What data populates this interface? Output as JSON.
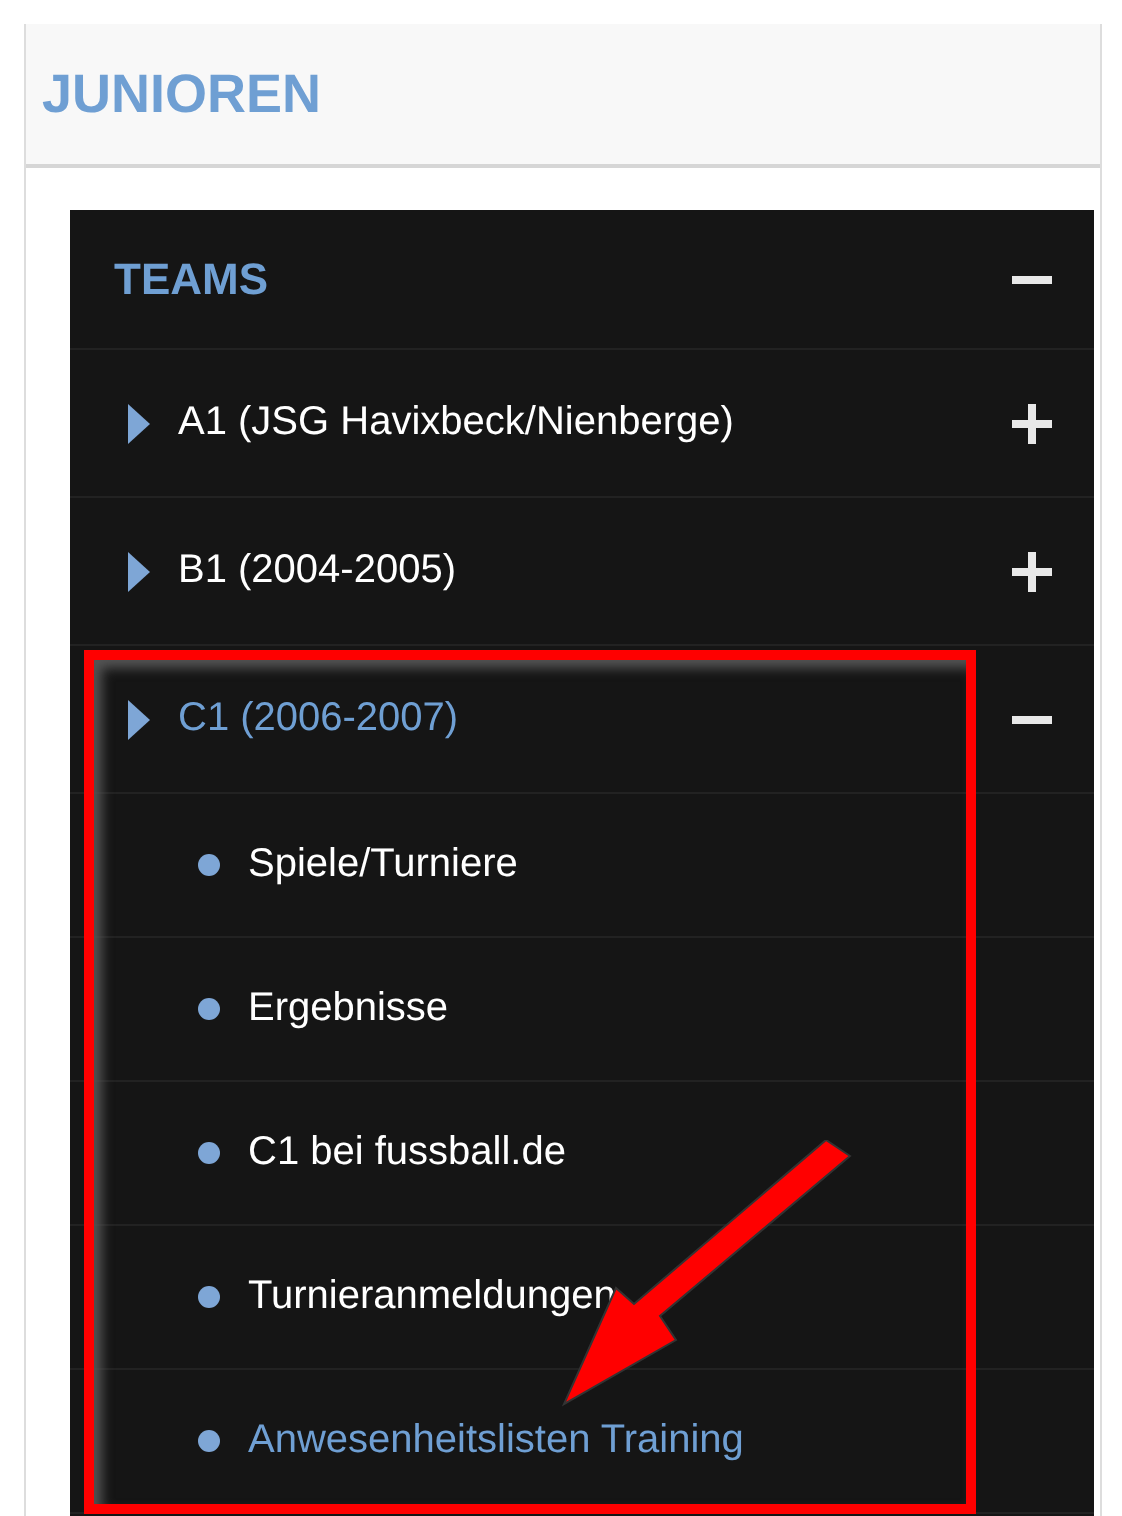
{
  "header": {
    "title": "JUNIOREN"
  },
  "menu": {
    "title": "TEAMS",
    "expanded": true,
    "teams": [
      {
        "label": "A1 (JSG Havixbeck/Nienberge)",
        "expanded": false,
        "selected": false
      },
      {
        "label": "B1 (2004-2005)",
        "expanded": false,
        "selected": false
      },
      {
        "label": "C1 (2006-2007)",
        "expanded": true,
        "selected": true,
        "children": [
          {
            "label": "Spiele/Turniere",
            "selected": false
          },
          {
            "label": "Ergebnisse",
            "selected": false
          },
          {
            "label": "C1 bei fussball.de",
            "selected": false
          },
          {
            "label": "Turnieranmeldungen",
            "selected": false
          },
          {
            "label": "Anwesenheitslisten Training",
            "selected": true
          }
        ]
      }
    ]
  }
}
